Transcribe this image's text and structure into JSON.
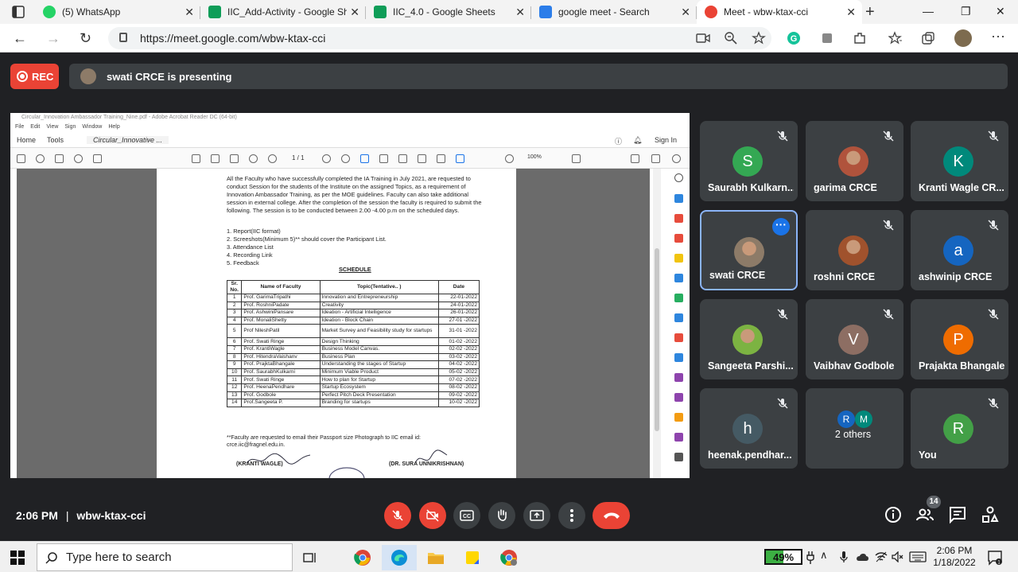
{
  "browser": {
    "tabs": [
      {
        "title": "(5) WhatsApp",
        "icon": "whatsapp-icon",
        "color": "#25d366"
      },
      {
        "title": "IIC_Add-Activity - Google She",
        "icon": "sheets-icon",
        "color": "#0f9d58"
      },
      {
        "title": "IIC_4.0 - Google Sheets",
        "icon": "sheets-icon",
        "color": "#0f9d58"
      },
      {
        "title": "google meet - Search",
        "icon": "bing-icon",
        "color": "#2b7de9"
      },
      {
        "title": "Meet - wbw-ktax-cci",
        "icon": "meet-icon",
        "color": "#ea4335"
      }
    ],
    "url": "https://meet.google.com/wbw-ktax-cci"
  },
  "meet": {
    "rec_label": "REC",
    "presenting_text": "swati CRCE is presenting",
    "time": "2:06 PM",
    "separator": "|",
    "meeting_code": "wbw-ktax-cci",
    "participant_count": "14",
    "participants": [
      {
        "name": "Saurabh Kulkarn...",
        "initial": "S",
        "color": "#34a853",
        "photo": false,
        "muted": true
      },
      {
        "name": "garima CRCE",
        "initial": "",
        "color": "#b0533c",
        "photo": true,
        "muted": true
      },
      {
        "name": "Kranti Wagle CR...",
        "initial": "K",
        "color": "#00897b",
        "photo": false,
        "muted": true
      },
      {
        "name": "swati CRCE",
        "initial": "",
        "color": "#8d7b68",
        "photo": true,
        "muted": false,
        "active": true
      },
      {
        "name": "roshni CRCE",
        "initial": "",
        "color": "#a0522d",
        "photo": true,
        "muted": true
      },
      {
        "name": "ashwinip CRCE",
        "initial": "a",
        "color": "#1565c0",
        "photo": false,
        "muted": true
      },
      {
        "name": "Sangeeta Parshi...",
        "initial": "",
        "color": "#7cb342",
        "photo": true,
        "muted": true
      },
      {
        "name": "Vaibhav Godbole",
        "initial": "V",
        "color": "#8d6e63",
        "photo": false,
        "muted": true
      },
      {
        "name": "Prajakta Bhangale",
        "initial": "P",
        "color": "#ef6c00",
        "photo": false,
        "muted": true
      },
      {
        "name": "heenak.pendhar...",
        "initial": "h",
        "color": "#455a64",
        "photo": false,
        "muted": true
      },
      {
        "name": "2 others",
        "initial": "",
        "color": "#1565c0",
        "photo": false,
        "muted": false,
        "others": [
          "R",
          "M"
        ]
      },
      {
        "name": "You",
        "initial": "R",
        "color": "#43a047",
        "photo": false,
        "muted": true
      }
    ]
  },
  "pdf": {
    "title_bar": "Circular_Innovation Ambassador Training_Nine.pdf - Adobe Acrobat Reader DC (64-bit)",
    "menu": [
      "File",
      "Edit",
      "View",
      "Sign",
      "Window",
      "Help"
    ],
    "home_tab": "Home",
    "tools_tab": "Tools",
    "doc_tab": "Circular_Innovative ...",
    "sign_in": "Sign In",
    "page_indicator": "1 / 1",
    "zoom": "100%",
    "paragraph": "All the Faculty who have successfully completed the IA Training in July 2021, are requested to conduct Session for the students of the Institute on the assigned Topics, as a requirement of Innovation Ambassador Training, as per the MOE guidelines. Faculty can also take additional session in external college. After the completion of the session the faculty is required to submit the following. The session is to be conducted between 2.00 -4.00 p.m on the scheduled days.",
    "requirements": [
      "1. Report(IIC format)",
      "2. Screeshots(Minimum 5)** should cover the Participant List.",
      "3. Attendance List",
      "4. Recording Link",
      "5. Feedback"
    ],
    "schedule_heading": "SCHEDULE",
    "table_headers": [
      "Sr. No.",
      "Name of Faculty",
      "Topic(Tentative.. )",
      "Date"
    ],
    "rows": [
      [
        "1",
        "Prof. GarimaTripathi",
        "Innovation and Entrepreneurship",
        "22-01-2022"
      ],
      [
        "2",
        "Prof. RoshniPadate",
        "Creativity",
        "24-01-2022"
      ],
      [
        "3",
        "Prof. AshwiniPansare",
        "Ideation - Artificial Intelligence",
        "26-01-2022"
      ],
      [
        "4",
        "Prof. MonaliShetty",
        "Ideation - Block Chain",
        "27-01 -2022"
      ],
      [
        "5",
        "Prof NileshPatil",
        "Market Survey and Feasibility study for startups",
        "31-01 -2022"
      ],
      [
        "6",
        "Prof. Swati Ringe",
        "Design Thinking",
        "01-02 -2022"
      ],
      [
        "7",
        "Prof. KrantiWagle",
        "Business Model Canvas.",
        "02-02 -2022"
      ],
      [
        "8",
        "Prof. HitendraVaishanv",
        "Business Plan",
        "03-02 -2022"
      ],
      [
        "9",
        "Prof. PrajktaBhangale",
        "Understanding the stages of Startup",
        "04-02 -2022"
      ],
      [
        "10",
        "Prof. SaurabhKulkarni",
        "Minimum Viable Product",
        "05-02 -2022"
      ],
      [
        "11",
        "Prof. Swati Ringe",
        "How to plan for Startup",
        "07-02 -2022"
      ],
      [
        "12",
        "Prof. HeenaPendhare",
        "Startup Ecosystem",
        "08-02 -2022"
      ],
      [
        "13",
        "Prof. Godbole",
        "Perfect Pitch Deck Presentation",
        "09-02 -2022"
      ],
      [
        "14",
        "Prof.Sangeeta P.",
        "Branding for startups",
        "10-02 -2022"
      ]
    ],
    "footnote": "**Faculty are requested to email their Passport size Photograph to IIC email id: crce.iic@fragnel.edu.in.",
    "signature_left": "(KRANTI WAGLE)",
    "signature_right": "(DR. SURA UNNIKRISHNAN)"
  },
  "taskbar": {
    "search_placeholder": "Type here to search",
    "battery": "49%",
    "clock_time": "2:06 PM",
    "clock_date": "1/18/2022"
  }
}
